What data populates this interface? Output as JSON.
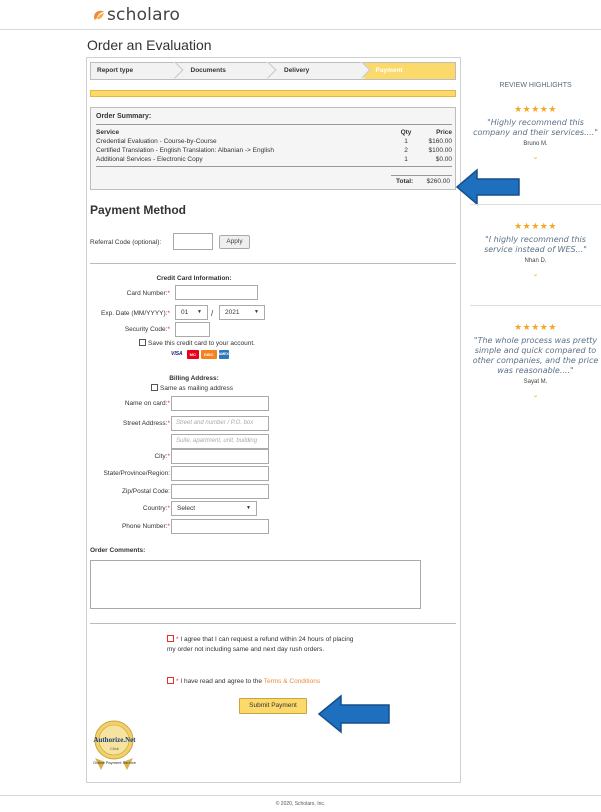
{
  "brand": {
    "name": "scholaro",
    "accent": "#f08a3c",
    "yellow": "#fcd96b",
    "arrow_blue": "#1f6fbf"
  },
  "page_title": "Order an Evaluation",
  "steps": [
    {
      "label": "Report type",
      "active": false
    },
    {
      "label": "Documents",
      "active": false
    },
    {
      "label": "Delivery",
      "active": false
    },
    {
      "label": "Payment",
      "active": true
    }
  ],
  "order_summary": {
    "title": "Order Summary:",
    "headers": {
      "service": "Service",
      "qty": "Qty",
      "price": "Price"
    },
    "rows": [
      {
        "service": "Credential Evaluation - Course-by-Course",
        "qty": "1",
        "price": "$160.00"
      },
      {
        "service": "Certified Translation - English Translation: Albanian -> English",
        "qty": "2",
        "price": "$100.00"
      },
      {
        "service": "Additional Services - Electronic Copy",
        "qty": "1",
        "price": "$0.00"
      }
    ],
    "total_label": "Total:",
    "total_value": "$260.00"
  },
  "payment_method": {
    "title": "Payment Method",
    "referral_label": "Referral Code (optional):",
    "apply_label": "Apply"
  },
  "credit_card": {
    "title": "Credit Card Information:",
    "card_number_label": "Card Number:",
    "exp_label": "Exp. Date (MM/YYYY):",
    "exp_month": "01",
    "exp_separator": "/",
    "exp_year": "2021",
    "security_label": "Security Code:",
    "save_label": "Save this credit card to your account.",
    "cards": [
      "VISA",
      "MC",
      "DISC",
      "AMEX"
    ]
  },
  "billing": {
    "title": "Billing Address:",
    "same_label": "Same as mailing address",
    "name_label": "Name on card:",
    "street_label": "Street Address:",
    "street_placeholder": "Street and number / P.O. box",
    "street2_placeholder": "Suite, apartment, unit, building",
    "city_label": "City:",
    "state_label": "State/Province/Region:",
    "zip_label": "Zip/Postal Code:",
    "country_label": "Country:",
    "country_value": "Select",
    "phone_label": "Phone Number:"
  },
  "comments_label": "Order Comments:",
  "agreements": {
    "refund_text": "I agree that I can request a refund within 24 hours of placing my order not including same and next day rush orders.",
    "terms_text": "I have read and agree to the",
    "terms_link": "Terms & Conditions"
  },
  "submit_label": "Submit Payment",
  "seal": {
    "name": "Authorize.Net",
    "sub": "Click",
    "caption": "Online Payment Service"
  },
  "reviews": {
    "heading": "REVIEW HIGHLIGHTS",
    "items": [
      {
        "stars": "★★★★★",
        "quote": "\"Highly recommend this company and their services....\"",
        "author": "Bruno M."
      },
      {
        "stars": "★★★★★",
        "quote": "\"I highly recommend this service instead of WES...\"",
        "author": "Nhan D."
      },
      {
        "stars": "★★★★★",
        "quote": "\"The whole process was pretty simple and quick compared to other companies, and the price was reasonable....\"",
        "author": "Sayat M."
      }
    ],
    "chevron": "⌄"
  },
  "footer": "© 2020, Scholaro, Inc."
}
